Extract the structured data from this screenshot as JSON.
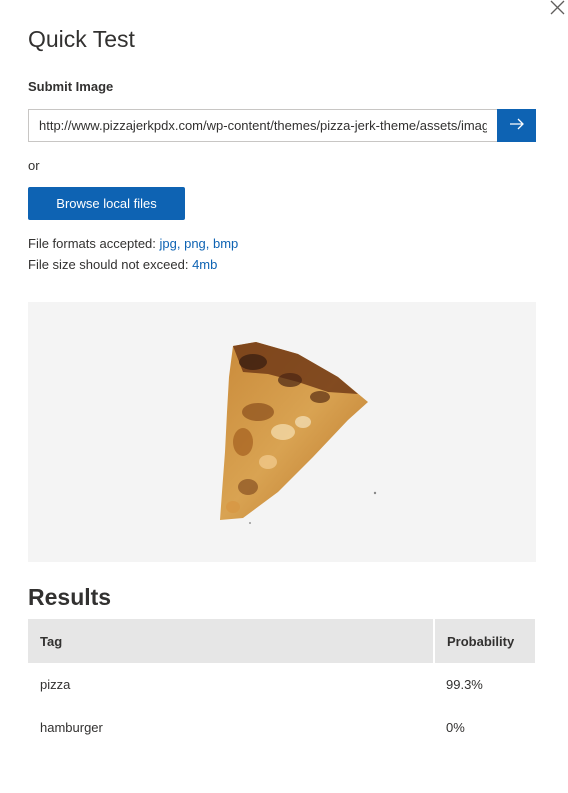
{
  "panel": {
    "title": "Quick Test"
  },
  "submit": {
    "section_label": "Submit Image",
    "url_value": "http://www.pizzajerkpdx.com/wp-content/themes/pizza-jerk-theme/assets/images/pizza.png",
    "submit_icon": "arrow-right-icon",
    "or_text": "or",
    "browse_label": "Browse local files",
    "formats_prefix": "File formats accepted:",
    "formats_list": "jpg, png, bmp",
    "size_prefix": "File size should not exceed:",
    "size_limit": "4mb"
  },
  "preview": {
    "image": "pizza-slice-image"
  },
  "results": {
    "title": "Results",
    "columns": [
      "Tag",
      "Probability"
    ],
    "rows": [
      {
        "tag": "pizza",
        "probability": "99.3%"
      },
      {
        "tag": "hamburger",
        "probability": "0%"
      }
    ]
  },
  "colors": {
    "accent": "#0e63b3",
    "text": "#323130",
    "table_header": "#e6e6e6",
    "preview_bg": "#f4f4f4"
  }
}
